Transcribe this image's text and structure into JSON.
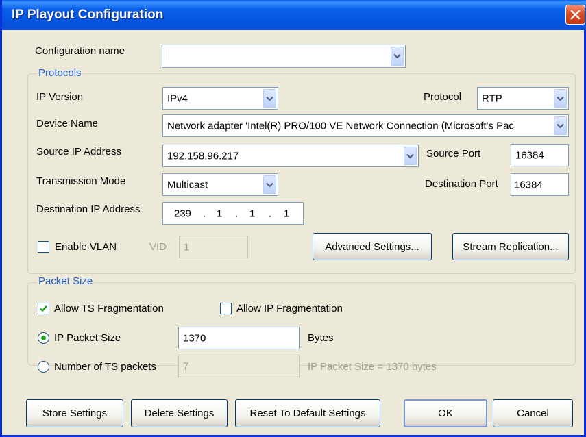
{
  "window": {
    "title": "IP Playout Configuration"
  },
  "config": {
    "label": "Configuration name",
    "value": ""
  },
  "protocols": {
    "legend": "Protocols",
    "ip_version": {
      "label": "IP Version",
      "value": "IPv4"
    },
    "protocol": {
      "label": "Protocol",
      "value": "RTP"
    },
    "device": {
      "label": "Device Name",
      "value": "Network adapter 'Intel(R) PRO/100 VE Network Connection (Microsoft's Pac"
    },
    "source_ip": {
      "label": "Source IP Address",
      "value": "192.158.96.217"
    },
    "source_port": {
      "label": "Source Port",
      "value": "16384"
    },
    "transmission": {
      "label": "Transmission Mode",
      "value": "Multicast"
    },
    "dest_port": {
      "label": "Destination Port",
      "value": "16384"
    },
    "dest_ip": {
      "label": "Destination IP Address",
      "octets": [
        "239",
        "1",
        "1",
        "1"
      ],
      "separator": "."
    },
    "vlan": {
      "label": "Enable VLAN",
      "checked": false,
      "vid_label": "VID",
      "vid_value": "1"
    },
    "advanced_label": "Advanced Settings...",
    "stream_label": "Stream Replication..."
  },
  "packet": {
    "legend": "Packet Size",
    "allow_ts": {
      "label": "Allow TS Fragmentation",
      "checked": true
    },
    "allow_ip": {
      "label": "Allow IP Fragmentation",
      "checked": false
    },
    "ip_packet_size": {
      "label": "IP Packet Size",
      "selected": true,
      "value": "1370",
      "unit": "Bytes"
    },
    "ts_packets": {
      "label": "Number of TS packets",
      "selected": false,
      "value": "7",
      "info": "IP Packet Size =  1370 bytes"
    }
  },
  "buttons": {
    "store": "Store Settings",
    "delete": "Delete Settings",
    "reset": "Reset To Default Settings",
    "ok": "OK",
    "cancel": "Cancel"
  },
  "colors": {
    "title_bar": "#0a5fe9",
    "legend": "#1f5ccf",
    "close": "#d8502a",
    "check": "#21a121"
  }
}
